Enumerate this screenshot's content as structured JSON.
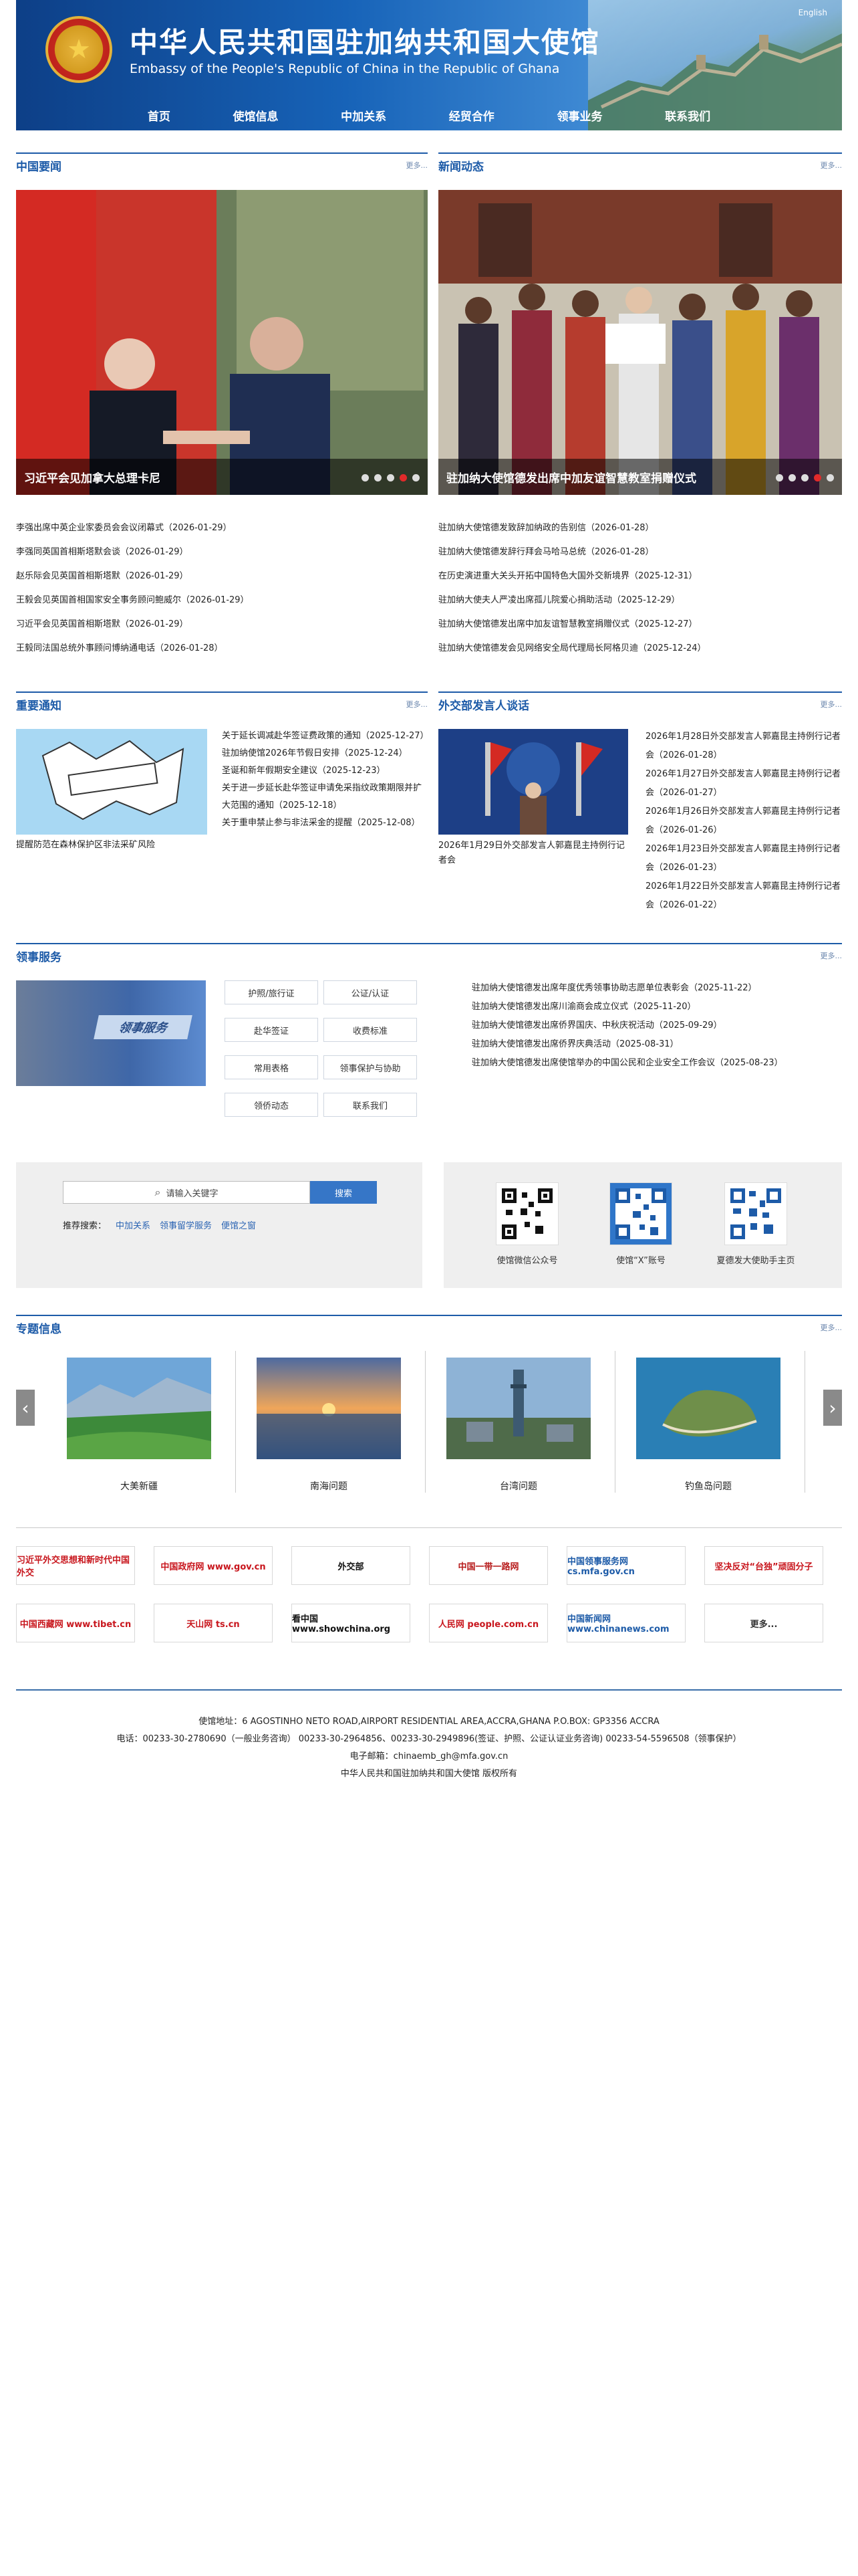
{
  "header": {
    "title_cn": "中华人民共和国驻加纳共和国大使馆",
    "title_en": "Embassy of the People's Republic of China in the Republic of Ghana",
    "lang_link": "English",
    "nav": [
      "首页",
      "使馆信息",
      "中加关系",
      "经贸合作",
      "领事业务",
      "联系我们"
    ]
  },
  "china_news": {
    "title": "中国要闻",
    "more": "更多...",
    "slide_caption": "习近平会见加拿大总理卡尼",
    "items": [
      "李强出席中英企业家委员会会议闭幕式（2026-01-29）",
      "李强同英国首相斯塔默会谈（2026-01-29）",
      "赵乐际会见英国首相斯塔默（2026-01-29）",
      "王毅会见英国首相国家安全事务顾问鲍威尔（2026-01-29）",
      "习近平会见英国首相斯塔默（2026-01-29）",
      "王毅同法国总统外事顾问博纳通电话（2026-01-28）"
    ]
  },
  "embassy_news": {
    "title": "新闻动态",
    "more": "更多...",
    "slide_caption": "驻加纳大使馆德发出席中加友谊智慧教室捐赠仪式",
    "items": [
      "驻加纳大使馆德发致辞加纳政的告别信（2026-01-28）",
      "驻加纳大使馆德发辞行拜会马哈马总统（2026-01-28）",
      "在历史演进重大关头开拓中国特色大国外交新境界（2025-12-31）",
      "驻加纳大使夫人严凌出席孤儿院爱心捐助活动（2025-12-29）",
      "驻加纳大使馆德发出席中加友谊智慧教室捐赠仪式（2025-12-27）",
      "驻加纳大使馆德发会见网络安全局代理局长阿格贝迪（2025-12-24）"
    ]
  },
  "notices": {
    "title": "重要通知",
    "more": "更多...",
    "image_caption": "提醒防范在森林保护区非法采矿风险",
    "items": [
      "关于延长调减赴华签证费政策的通知（2025-12-27）",
      "驻加纳使馆2026年节假日安排（2025-12-24）",
      "圣诞和新年假期安全建议（2025-12-23）",
      "关于进一步延长赴华签证申请免采指纹政策期限并扩大范围的通知（2025-12-18）",
      "关于重申禁止参与非法采金的提醒（2025-12-08）"
    ]
  },
  "spokesperson": {
    "title": "外交部发言人谈话",
    "more": "更多...",
    "image_caption": "2026年1月29日外交部发言人郭嘉昆主持例行记者会",
    "items": [
      "2026年1月28日外交部发言人郭嘉昆主持例行记者会（2026-01-28）",
      "2026年1月27日外交部发言人郭嘉昆主持例行记者会（2026-01-27）",
      "2026年1月26日外交部发言人郭嘉昆主持例行记者会（2026-01-26）",
      "2026年1月23日外交部发言人郭嘉昆主持例行记者会（2026-01-23）",
      "2026年1月22日外交部发言人郭嘉昆主持例行记者会（2026-01-22）"
    ]
  },
  "consular": {
    "title": "领事服务",
    "more": "更多...",
    "banner_text": "领事服务",
    "buttons": [
      "护照/旅行证",
      "公证/认证",
      "赴华签证",
      "收费标准",
      "常用表格",
      "领事保护与协助",
      "领侨动态",
      "联系我们"
    ],
    "items": [
      "驻加纳大使馆德发出席年度优秀领事协助志愿单位表彰会（2025-11-22）",
      "驻加纳大使馆德发出席川渝商会成立仪式（2025-11-20）",
      "驻加纳大使馆德发出席侨界国庆、中秋庆祝活动（2025-09-29）",
      "驻加纳大使馆德发出席侨界庆典活动（2025-08-31）",
      "驻加纳大使馆德发出席使馆举办的中国公民和企业安全工作会议（2025-08-23）"
    ]
  },
  "search": {
    "placeholder": "请输入关键字",
    "button": "搜索",
    "recommend_label": "推荐搜索：",
    "recommend": [
      "中加关系",
      "领事留学服务",
      "便馆之窗"
    ]
  },
  "qrcodes": [
    "使馆微信公众号",
    "使馆“X”账号",
    "夏德发大使助手主页"
  ],
  "topics": {
    "title": "专题信息",
    "more": "更多...",
    "items": [
      "大美新疆",
      "南海问题",
      "台湾问题",
      "钓鱼岛问题"
    ],
    "prev": "‹",
    "next": "›"
  },
  "links": [
    {
      "text": "习近平外交思想和新时代中国外交",
      "color": "#c8161d"
    },
    {
      "text": "中国政府网 www.gov.cn",
      "color": "#c8161d"
    },
    {
      "text": "外交部",
      "color": "#111111"
    },
    {
      "text": "中国一带一路网",
      "color": "#b71c1c"
    },
    {
      "text": "中国领事服务网 cs.mfa.gov.cn",
      "color": "#1d5ba8"
    },
    {
      "text": "坚决反对“台独”顽固分子",
      "color": "#c8161d"
    },
    {
      "text": "中国西藏网 www.tibet.cn",
      "color": "#c8161d"
    },
    {
      "text": "天山网 ts.cn",
      "color": "#c8161d"
    },
    {
      "text": "看中国 www.showchina.org",
      "color": "#111111"
    },
    {
      "text": "人民网 people.com.cn",
      "color": "#c8161d"
    },
    {
      "text": "中国新闻网 www.chinanews.com",
      "color": "#1d5ba8"
    },
    {
      "text": "更多...",
      "color": "#333333"
    }
  ],
  "footer": {
    "address": "使馆地址：6 AGOSTINHO NETO ROAD,AIRPORT RESIDENTIAL AREA,ACCRA,GHANA P.O.BOX: GP3356 ACCRA",
    "phone": "电话：00233-30-2780690（一般业务咨询） 00233-30-2964856、00233-30-2949896(签证、护照、公证认证业务咨询) 00233-54-5596508（领事保护）",
    "email": "电子邮箱：chinaemb_gh@mfa.gov.cn",
    "copyright": "中华人民共和国驻加纳共和国大使馆 版权所有"
  }
}
